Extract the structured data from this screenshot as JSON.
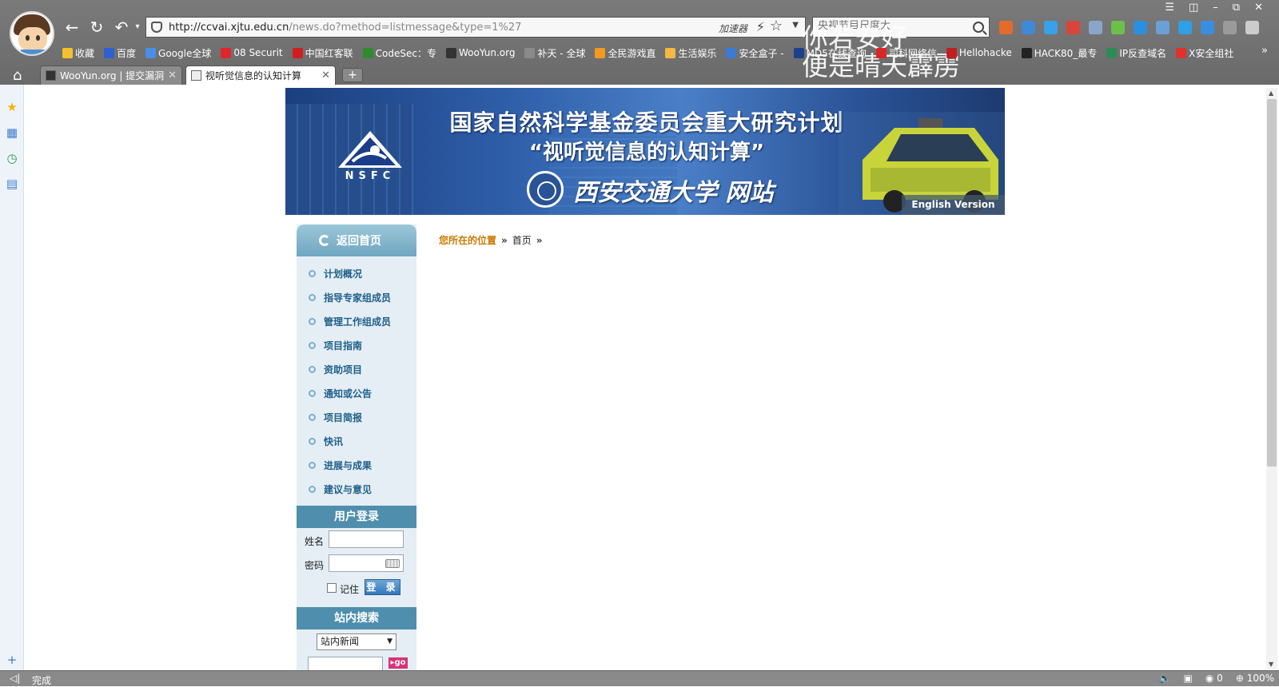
{
  "browser": {
    "url_host": "http://ccvai.xjtu.edu.cn",
    "url_path": "/news.do?method=listmessage&type=1%27",
    "accelerator_label": "加速器",
    "search_placeholder": "央视节目尺度大",
    "overlay_line1": "你若安好",
    "overlay_line2": "便是晴天霹雳",
    "bookmarks": [
      {
        "label": "收藏",
        "color": "#f2c12e"
      },
      {
        "label": "百度",
        "color": "#2f5fd0"
      },
      {
        "label": "Google全球",
        "color": "#4a8ee8"
      },
      {
        "label": "08 Securit",
        "color": "#e0262a"
      },
      {
        "label": "中国红客联",
        "color": "#d11f1f"
      },
      {
        "label": "CodeSec：专",
        "color": "#2e8b2e"
      },
      {
        "label": "WooYun.org",
        "color": "#333333"
      },
      {
        "label": "补天 - 全球",
        "color": "#8a8a8a"
      },
      {
        "label": "全民游戏直",
        "color": "#f29a1e"
      },
      {
        "label": "生活娱乐",
        "color": "#f4b942"
      },
      {
        "label": "安全盒子 -",
        "color": "#3a7bd5"
      },
      {
        "label": "MD5在线查询",
        "color": "#1e3f8c"
      },
      {
        "label": "司科网络信",
        "color": "#d92626"
      },
      {
        "label": "Hellohacke",
        "color": "#c22020"
      },
      {
        "label": "HACK80_最专",
        "color": "#222222"
      },
      {
        "label": "IP反查域名",
        "color": "#2e8b57"
      },
      {
        "label": "X安全组社",
        "color": "#e03030"
      }
    ],
    "tabs": [
      {
        "label": "WooYun.org | 提交漏洞"
      },
      {
        "label": "视听觉信息的认知计算"
      }
    ],
    "status_text": "完成",
    "status_count": "0",
    "zoom": "100%",
    "toolbar_icon_colors": [
      "#e36b2c",
      "#3f89d6",
      "#3aa0e8",
      "#d8463b",
      "#8aa5cc",
      "#6cc04a",
      "#2b8fe0",
      "#6b9fd6",
      "#2e9fe8",
      "#3a8ee0",
      "#9a9a9a",
      "#cccccc"
    ]
  },
  "banner": {
    "title_line1": "国家自然科学基金委员会重大研究计划",
    "title_line2": "“视听觉信息的认知计算”",
    "title_line3": "西安交通大学 网站",
    "logo_text": "NSFC",
    "english_version": "English Version"
  },
  "sidebar": {
    "home_label": "返回首页",
    "menu": [
      {
        "label": "计划概况"
      },
      {
        "label": "指导专家组成员"
      },
      {
        "label": "管理工作组成员"
      },
      {
        "label": "项目指南"
      },
      {
        "label": "资助项目"
      },
      {
        "label": "通知或公告"
      },
      {
        "label": "项目简报"
      },
      {
        "label": "快讯"
      },
      {
        "label": "进展与成果"
      },
      {
        "label": "建议与意见"
      }
    ],
    "login_title": "用户登录",
    "name_label": "姓名",
    "password_label": "密码",
    "remember_label": "记住",
    "login_button": "登 录",
    "search_title": "站内搜索",
    "search_scope": "站内新闻",
    "go_label": "▸go"
  },
  "breadcrumb": {
    "label": "您所在的位置",
    "sep": "»",
    "home": "首页"
  }
}
